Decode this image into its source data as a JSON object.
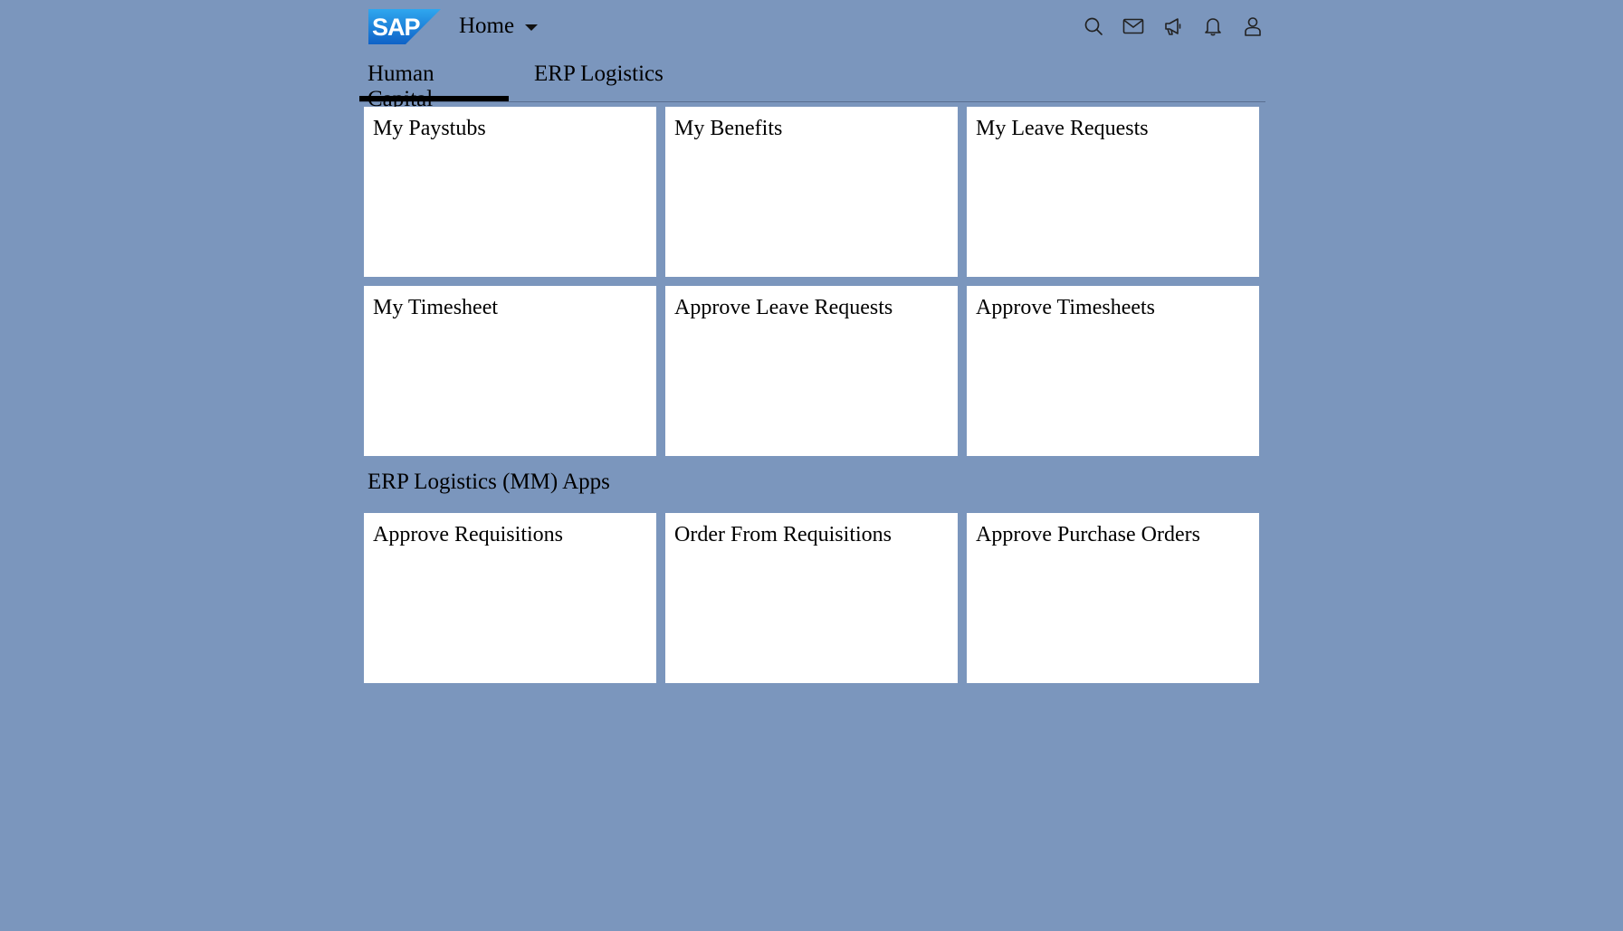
{
  "header": {
    "logo_text": "SAP",
    "home_label": "Home",
    "icons": [
      "search-icon",
      "mail-icon",
      "megaphone-icon",
      "bell-icon",
      "user-icon"
    ]
  },
  "tabs": [
    {
      "label": "Human Capital"
    },
    {
      "label": "ERP Logistics"
    }
  ],
  "human_capital": {
    "tiles": [
      {
        "title": "My Paystubs"
      },
      {
        "title": "My Benefits"
      },
      {
        "title": "My Leave Requests"
      },
      {
        "title": "My Timesheet"
      },
      {
        "title": "Approve Leave Requests"
      },
      {
        "title": "Approve Timesheets"
      }
    ]
  },
  "erp_logistics": {
    "section_title": "ERP Logistics (MM) Apps",
    "tiles": [
      {
        "title": "Approve Requisitions"
      },
      {
        "title": "Order From Requisitions"
      },
      {
        "title": "Approve Purchase Orders"
      }
    ]
  },
  "colors": {
    "background": "#7b96bd",
    "tile": "#ffffff",
    "active_tab_underline": "#000000",
    "logo_top": "#2fa7ef",
    "logo_bottom": "#0f62c7"
  }
}
